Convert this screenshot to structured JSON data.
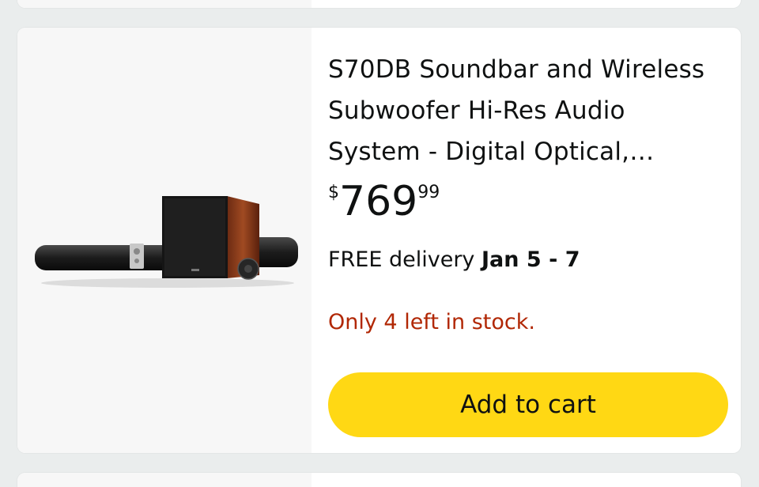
{
  "product": {
    "title": "S70DB Soundbar and Wireless Subwoofer Hi-Res Audio System - Digital Optical,…",
    "price": {
      "symbol": "$",
      "whole": "769",
      "fraction": "99"
    },
    "delivery": {
      "prefix": "FREE delivery",
      "date": "Jan 5 - 7"
    },
    "stock": "Only 4 left in stock.",
    "add_to_cart_label": "Add to cart"
  },
  "colors": {
    "button": "#ffd814",
    "stock_text": "#b12704",
    "text": "#0f1111",
    "image_panel": "#f7f7f7",
    "background": "#eaeded"
  }
}
